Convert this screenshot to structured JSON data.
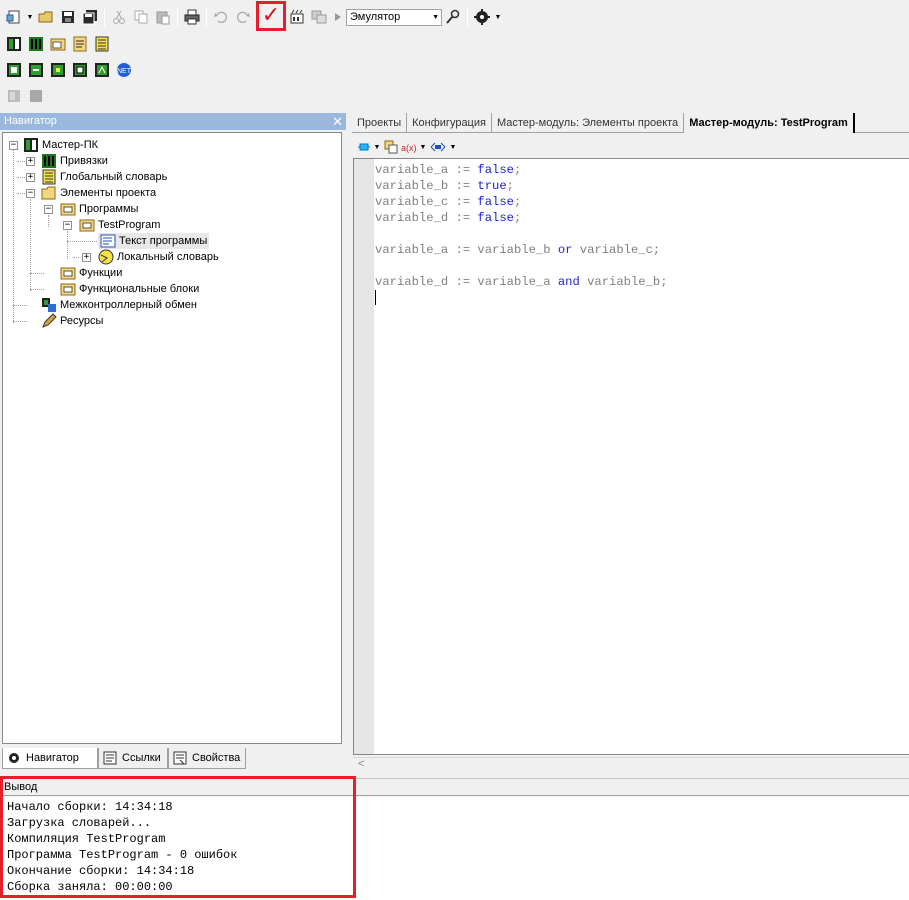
{
  "toolbar": {
    "target_value": "Эмулятор",
    "build_check_glyph": "✓"
  },
  "navigator": {
    "title": "Навигатор",
    "close_glyph": "✕",
    "tree": {
      "root": "Мастер-ПК",
      "bindings": "Привязки",
      "global_dict": "Глобальный словарь",
      "project_elements": "Элементы проекта",
      "programs": "Программы",
      "test_program": "TestProgram",
      "program_text": "Текст программы",
      "local_dict": "Локальный словарь",
      "functions": "Функции",
      "function_blocks": "Функциональные блоки",
      "intercontroller": "Межконтроллерный обмен",
      "resources": "Ресурсы"
    },
    "bottom_tabs": {
      "navigator": "Навигатор",
      "links": "Ссылки",
      "properties": "Свойства"
    }
  },
  "documents": {
    "tabs": [
      "Проекты",
      "Конфигурация",
      "Мастер-модуль: Элементы проекта",
      "Мастер-модуль: TestProgram"
    ],
    "active_tab": "Мастер-модуль: TestProgram"
  },
  "code": {
    "lines": [
      [
        {
          "t": "variable_a := "
        },
        {
          "t": "false",
          "kw": true
        },
        {
          "t": ";"
        }
      ],
      [
        {
          "t": "variable_b := "
        },
        {
          "t": "true",
          "kw": true
        },
        {
          "t": ";"
        }
      ],
      [
        {
          "t": "variable_c := "
        },
        {
          "t": "false",
          "kw": true
        },
        {
          "t": ";"
        }
      ],
      [
        {
          "t": "variable_d := "
        },
        {
          "t": "false",
          "kw": true
        },
        {
          "t": ";"
        }
      ],
      [],
      [
        {
          "t": "variable_a := variable_b "
        },
        {
          "t": "or",
          "kw": true
        },
        {
          "t": " variable_c;"
        }
      ],
      [],
      [
        {
          "t": "variable_d := variable_a "
        },
        {
          "t": "and",
          "kw": true
        },
        {
          "t": " variable_b;"
        }
      ]
    ]
  },
  "output": {
    "title": "Вывод",
    "lines": [
      "Начало сборки: 14:34:18",
      "Загрузка словарей...",
      "Компиляция TestProgram",
      "Программа TestProgram - 0 ошибок",
      "Окончание сборки: 14:34:18",
      "Сборка заняла: 00:00:00"
    ]
  },
  "colors": {
    "highlight": "#e5202a",
    "keyword": "#1e1edc",
    "identifier": "#808080",
    "panel_title": "#9ab8dd"
  }
}
